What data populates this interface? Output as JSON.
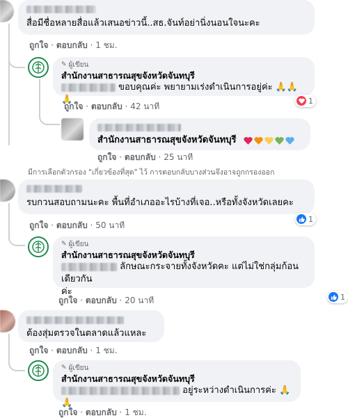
{
  "comment1": {
    "text": "สื่อมีชื่อหลายสื่อแล้วเสนอข่าวนี้..สธ.จันท์อย่านิ่งนอนใจนะคะ",
    "like": "ถูกใจ",
    "reply": "ตอบกลับ",
    "time": "1 ชม."
  },
  "reply1": {
    "author_tag": "ผู้เขียน",
    "name": "สำนักงานสาธารณสุขจังหวัดจันทบุรี",
    "text": "ขอบคุณค่ะ พยายามเร่งดำเนินการอยู่ค่ะ 🙏🙏🙏",
    "like": "ถูกใจ",
    "reply": "ตอบกลับ",
    "time": "42 นาที",
    "reaction_count": "1"
  },
  "reply2": {
    "text": "สำนักงานสาธารณสุขจังหวัดจันทบุรี",
    "like": "ถูกใจ",
    "reply": "ตอบกลับ",
    "time": "25 นาที"
  },
  "filter_notice": "มีการเลือกตัวกรอง \"เกี่ยวข้องที่สุด\" ไว้ การตอบกลับบางส่วนจึงอาจถูกกรองออก",
  "comment2": {
    "text": "รบกวนสอบถามนะคะ พื้นที่อำเภออะไรบ้างที่เจอ..หรือทั้งจังหวัดเลยคะ",
    "like": "ถูกใจ",
    "reply": "ตอบกลับ",
    "time": "50 นาที",
    "reaction_count": "1"
  },
  "reply3": {
    "author_tag": "ผู้เขียน",
    "name": "สำนักงานสาธารณสุขจังหวัดจันทบุรี",
    "text_line1": "ลักษณะกระจายทั้งจังหวัดคะ แต่ไม่ใช่กลุ่มก้อนเดียวกัน",
    "text_line2": "ค่ะ",
    "like": "ถูกใจ",
    "reply": "ตอบกลับ",
    "time": "20 นาที",
    "reaction_count": "1"
  },
  "comment3": {
    "text": "ต้องสุ่มตรวจในตลาดแล้วแหละ",
    "like": "ถูกใจ",
    "reply": "ตอบกลับ",
    "time": "1 ชม."
  },
  "reply4": {
    "author_tag": "ผู้เขียน",
    "name": "สำนักงานสาธารณสุขจังหวัดจันทบุรี",
    "text": "อยู่ระหว่างดำเนินการค่ะ 🙏🙏",
    "like": "ถูกใจ",
    "reply": "ตอบกลับ",
    "time": "1 ชม."
  },
  "colors": {
    "bubble": "#f0f2f5",
    "meta_text": "#65676b",
    "org_green": "#1e8a4c",
    "like_blue": "#1877f2",
    "love_red": "#f33e58"
  }
}
